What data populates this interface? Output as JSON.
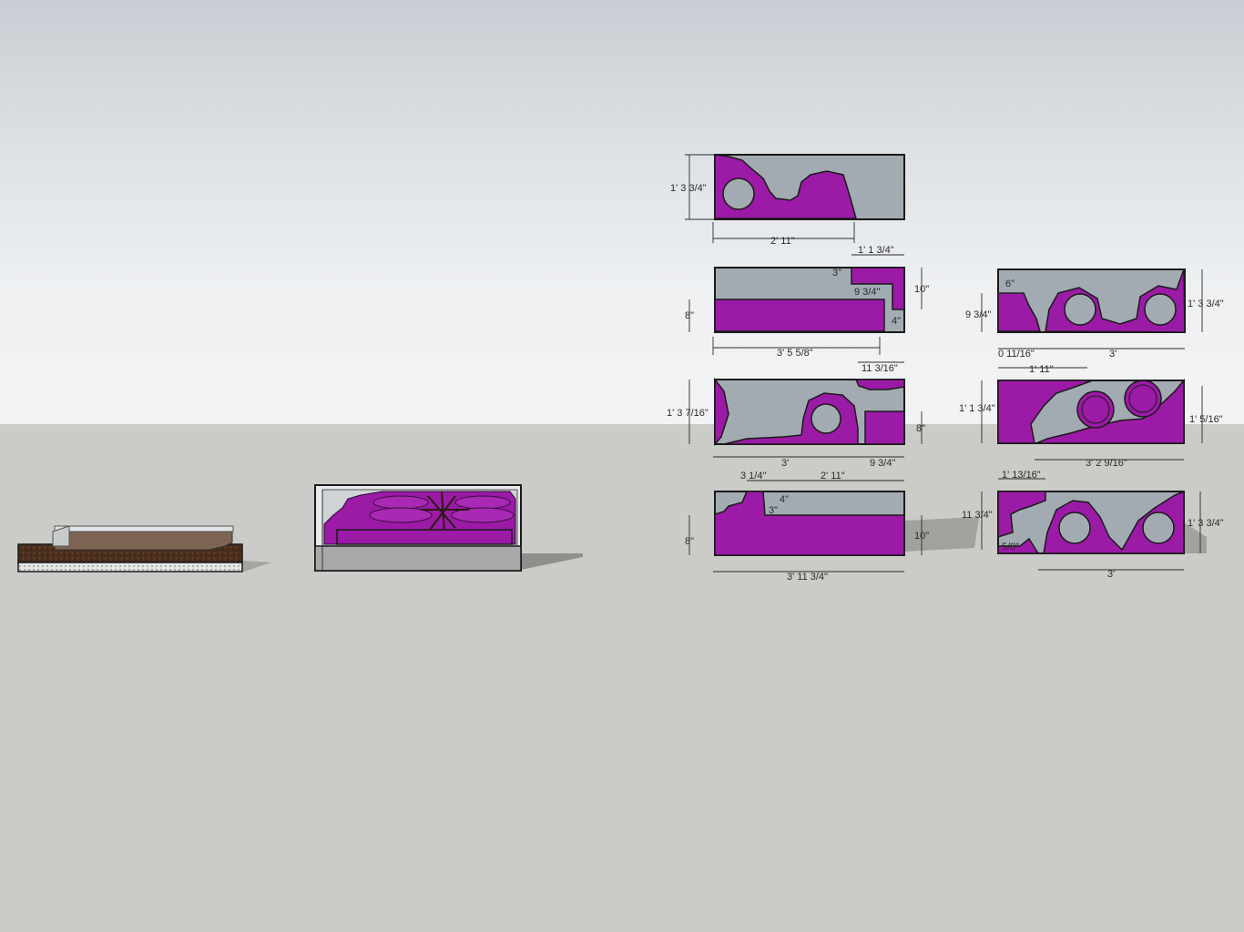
{
  "colors": {
    "sky_top": "#c9ced4",
    "sky_horizon": "#f2f3f5",
    "ground": "#cbccc7",
    "panel_gray": "#a3abb2",
    "foam_purple": "#9b1aa6",
    "edge": "#1a1a1a",
    "soil_brown": "#4a2e1e"
  },
  "panels": {
    "p1": {
      "height_dim": "1' 3 3/4\"",
      "width_dim": "2' 11\""
    },
    "p2": {
      "top_dim": "1' 1 3/4\"",
      "notch_dim": "3\"",
      "inner_dim": "9 3/4\"",
      "right_dim": "10\"",
      "small_dim": "4\"",
      "left_dim": "8\"",
      "width_dim": "3' 5 5/8\""
    },
    "p3": {
      "top_dim": "11 3/16\"",
      "height_dim": "1' 3 7/16\"",
      "right_dim": "8\"",
      "left_width_dim": "3'",
      "right_width_dim": "9 3/4\""
    },
    "p4": {
      "top_left_dim": "3 1/4\"",
      "top_width_dim": "2' 11\"",
      "small_dim": "4\"",
      "small_dim2": "3\"",
      "left_dim": "8\"",
      "right_dim": "10\"",
      "width_dim": "3' 11 3/4\""
    },
    "p5": {
      "top_dim": "6\"",
      "left_dim": "9 3/4\"",
      "right_dim": "1' 3 3/4\"",
      "bottom_left_dim": "0 11/16\"",
      "bottom_width_dim": "3'"
    },
    "p6": {
      "top_dim": "1' 11\"",
      "left_dim": "1' 1 3/4\"",
      "right_dim": "1' 5/16\"",
      "bottom_dim": "3' 2 9/16\""
    },
    "p7": {
      "top_dim": "1' 13/16\"",
      "left_dim": "11 3/4\"",
      "small_dim": "5/8\"",
      "right_dim": "1' 3 3/4\"",
      "bottom_dim": "3'"
    }
  }
}
